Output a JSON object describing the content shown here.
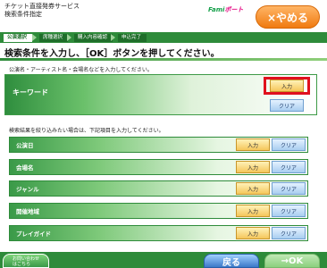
{
  "header": {
    "app_title_line1": "チケット直接発券サービス",
    "app_title_line2": "検索条件指定",
    "brand_prefix": "Fami",
    "brand_suffix": "ポート",
    "quit_label": "×やめる"
  },
  "steps": [
    {
      "label": "公演選択",
      "active": true
    },
    {
      "label": "席種選択",
      "active": false
    },
    {
      "label": "購入内容確認",
      "active": false
    },
    {
      "label": "申込完了",
      "active": false
    }
  ],
  "page_heading": "検索条件を入力し、［OK］ボタンを押してください。",
  "keyword_section": {
    "instruction": "公演名・アーティスト名・会場名などを入力してください。",
    "label": "キーワード",
    "input_label": "入力",
    "clear_label": "クリア"
  },
  "filter_section": {
    "instruction": "検索結果を絞り込みたい場合は、下記項目を入力してください。",
    "rows": [
      {
        "label": "公演日",
        "input_label": "入力",
        "clear_label": "クリア"
      },
      {
        "label": "会場名",
        "input_label": "入力",
        "clear_label": "クリア"
      },
      {
        "label": "ジャンル",
        "input_label": "入力",
        "clear_label": "クリア"
      },
      {
        "label": "開催地域",
        "input_label": "入力",
        "clear_label": "クリア"
      },
      {
        "label": "プレイガイド",
        "input_label": "入力",
        "clear_label": "クリア"
      }
    ]
  },
  "footer": {
    "contact_line1": "お問い合わせ",
    "contact_line2": "はこちら",
    "back_label": "戻る",
    "ok_label": "→OK"
  },
  "colors": {
    "primary_green": "#2e8b3a",
    "accent_orange": "#f07a10",
    "highlight_red": "#e0101e"
  }
}
